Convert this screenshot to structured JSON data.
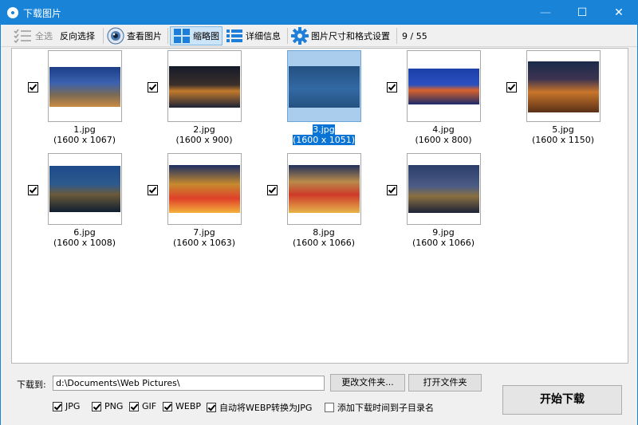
{
  "window": {
    "title": "下载图片",
    "min_glyph": "—",
    "max_glyph": "☐",
    "close_glyph": "✕"
  },
  "toolbar": {
    "select_all": "全选",
    "invert_selection": "反向选择",
    "view_image": "查看图片",
    "thumbnails": "缩略图",
    "details": "详细信息",
    "size_format_settings": "图片尺寸和格式设置",
    "count": "9 / 55"
  },
  "images": [
    {
      "name": "1.jpg",
      "dims": "(1600 x 1067)",
      "checked": true,
      "selected": false
    },
    {
      "name": "2.jpg",
      "dims": "(1600 x 900)",
      "checked": true,
      "selected": false
    },
    {
      "name": "3.jpg",
      "dims": "(1600 x 1051)",
      "checked": false,
      "selected": true
    },
    {
      "name": "4.jpg",
      "dims": "(1600 x 800)",
      "checked": true,
      "selected": false
    },
    {
      "name": "5.jpg",
      "dims": "(1600 x 1150)",
      "checked": true,
      "selected": false
    },
    {
      "name": "6.jpg",
      "dims": "(1600 x 1008)",
      "checked": true,
      "selected": false
    },
    {
      "name": "7.jpg",
      "dims": "(1600 x 1063)",
      "checked": true,
      "selected": false
    },
    {
      "name": "8.jpg",
      "dims": "(1600 x 1066)",
      "checked": true,
      "selected": false
    },
    {
      "name": "9.jpg",
      "dims": "(1600 x 1066)",
      "checked": true,
      "selected": false
    }
  ],
  "download": {
    "label": "下载到:",
    "path": "d:\\Documents\\Web Pictures\\",
    "change_folder": "更改文件夹...",
    "open_folder": "打开文件夹",
    "start": "开始下载"
  },
  "options": [
    {
      "label": "JPG",
      "checked": true
    },
    {
      "label": "PNG",
      "checked": true
    },
    {
      "label": "GIF",
      "checked": true
    },
    {
      "label": "WEBP",
      "checked": true
    },
    {
      "label": "自动将WEBP转换为JPG",
      "checked": true
    },
    {
      "label": "添加下载时间到子目录名",
      "checked": false
    }
  ],
  "colors": {
    "accent": "#1883d7",
    "selection": "#0a74d6"
  }
}
